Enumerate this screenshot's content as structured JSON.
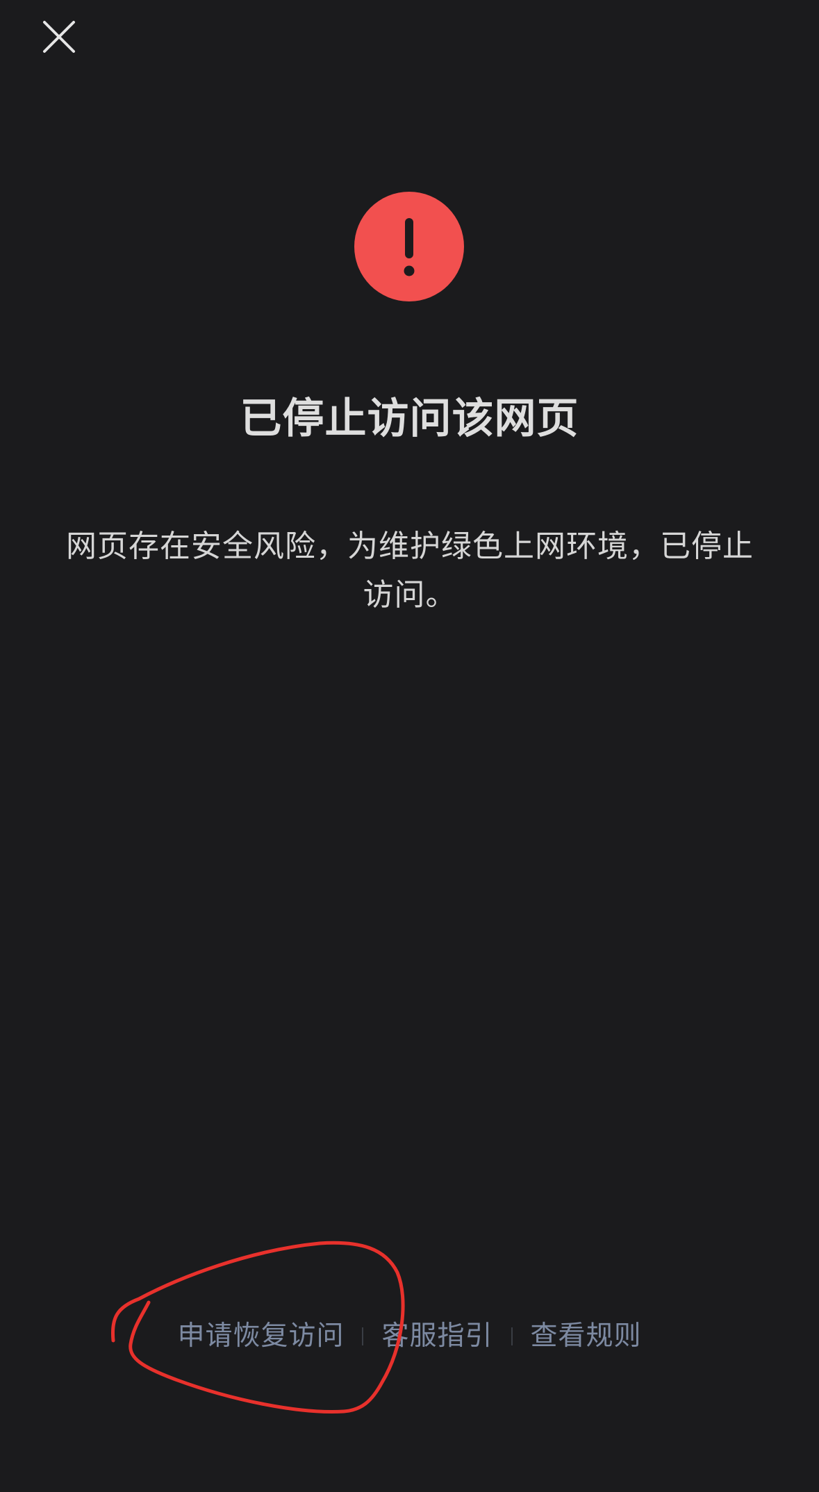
{
  "header": {
    "close_icon": "close-icon"
  },
  "alert": {
    "icon": "exclamation-icon",
    "color": "#f2504f"
  },
  "main": {
    "title": "已停止访问该网页",
    "description": "网页存在安全风险，为维护绿色上网环境，已停止访问。"
  },
  "footer": {
    "links": [
      {
        "label": "申请恢复访问"
      },
      {
        "label": "客服指引"
      },
      {
        "label": "查看规则"
      }
    ],
    "link_color": "#7d8aa2"
  },
  "annotation": {
    "color": "#e8312c"
  }
}
